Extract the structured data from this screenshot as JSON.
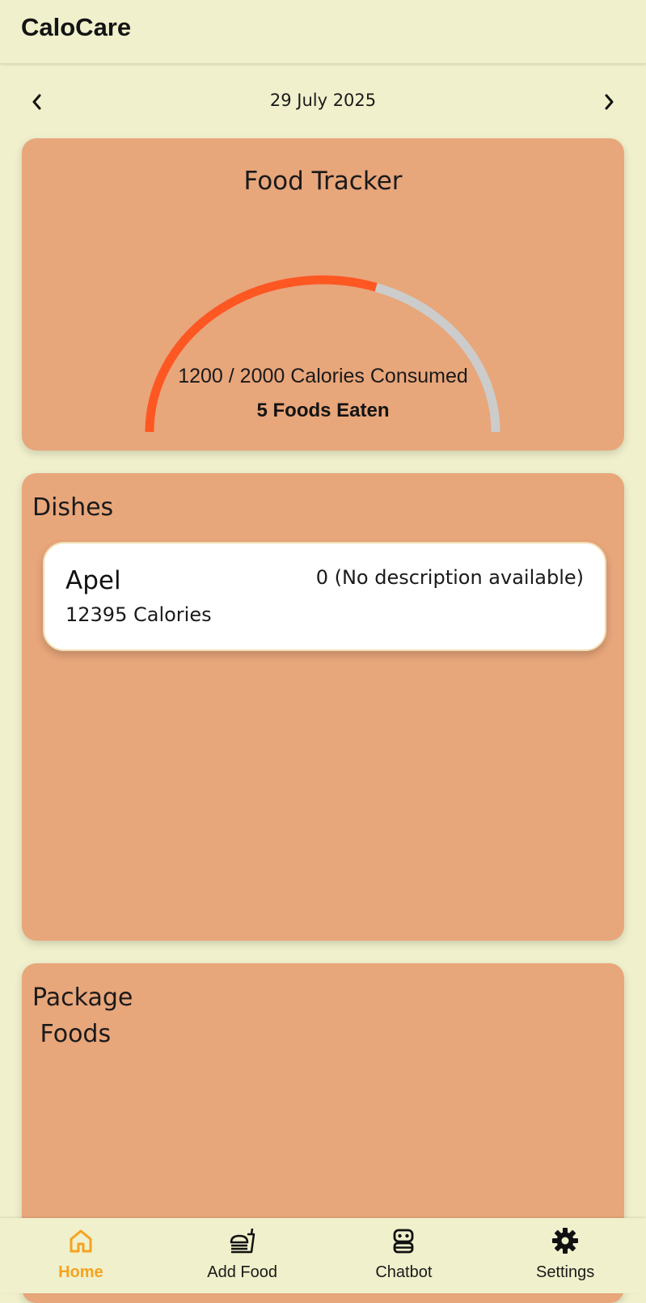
{
  "app": {
    "title": "CaloCare"
  },
  "date_nav": {
    "date": "29 July 2025",
    "prev_icon": "chevron-left-icon",
    "next_icon": "chevron-right-icon"
  },
  "tracker": {
    "title": "Food Tracker",
    "consumed": 1200,
    "goal": 2000,
    "progress_fraction": 0.6,
    "calories_text": "1200 / 2000 Calories Consumed",
    "foods_eaten_text": "5 Foods Eaten",
    "colors": {
      "progress": "#ff5722",
      "track": "#cccccc"
    }
  },
  "dishes": {
    "title": "Dishes",
    "items": [
      {
        "name": "Apel",
        "calories": "12395 Calories",
        "description": "0 (No description available)"
      }
    ]
  },
  "package_foods": {
    "title": "Package\n Foods"
  },
  "bottom_nav": {
    "items": [
      {
        "label": "Home",
        "icon": "home-icon",
        "active": true
      },
      {
        "label": "Add Food",
        "icon": "fastfood-icon",
        "active": false
      },
      {
        "label": "Chatbot",
        "icon": "robot-icon",
        "active": false
      },
      {
        "label": "Settings",
        "icon": "gear-icon",
        "active": false
      }
    ]
  },
  "colors": {
    "background": "#f0f0cc",
    "card": "#e8a67b",
    "accent": "#f5a320"
  }
}
